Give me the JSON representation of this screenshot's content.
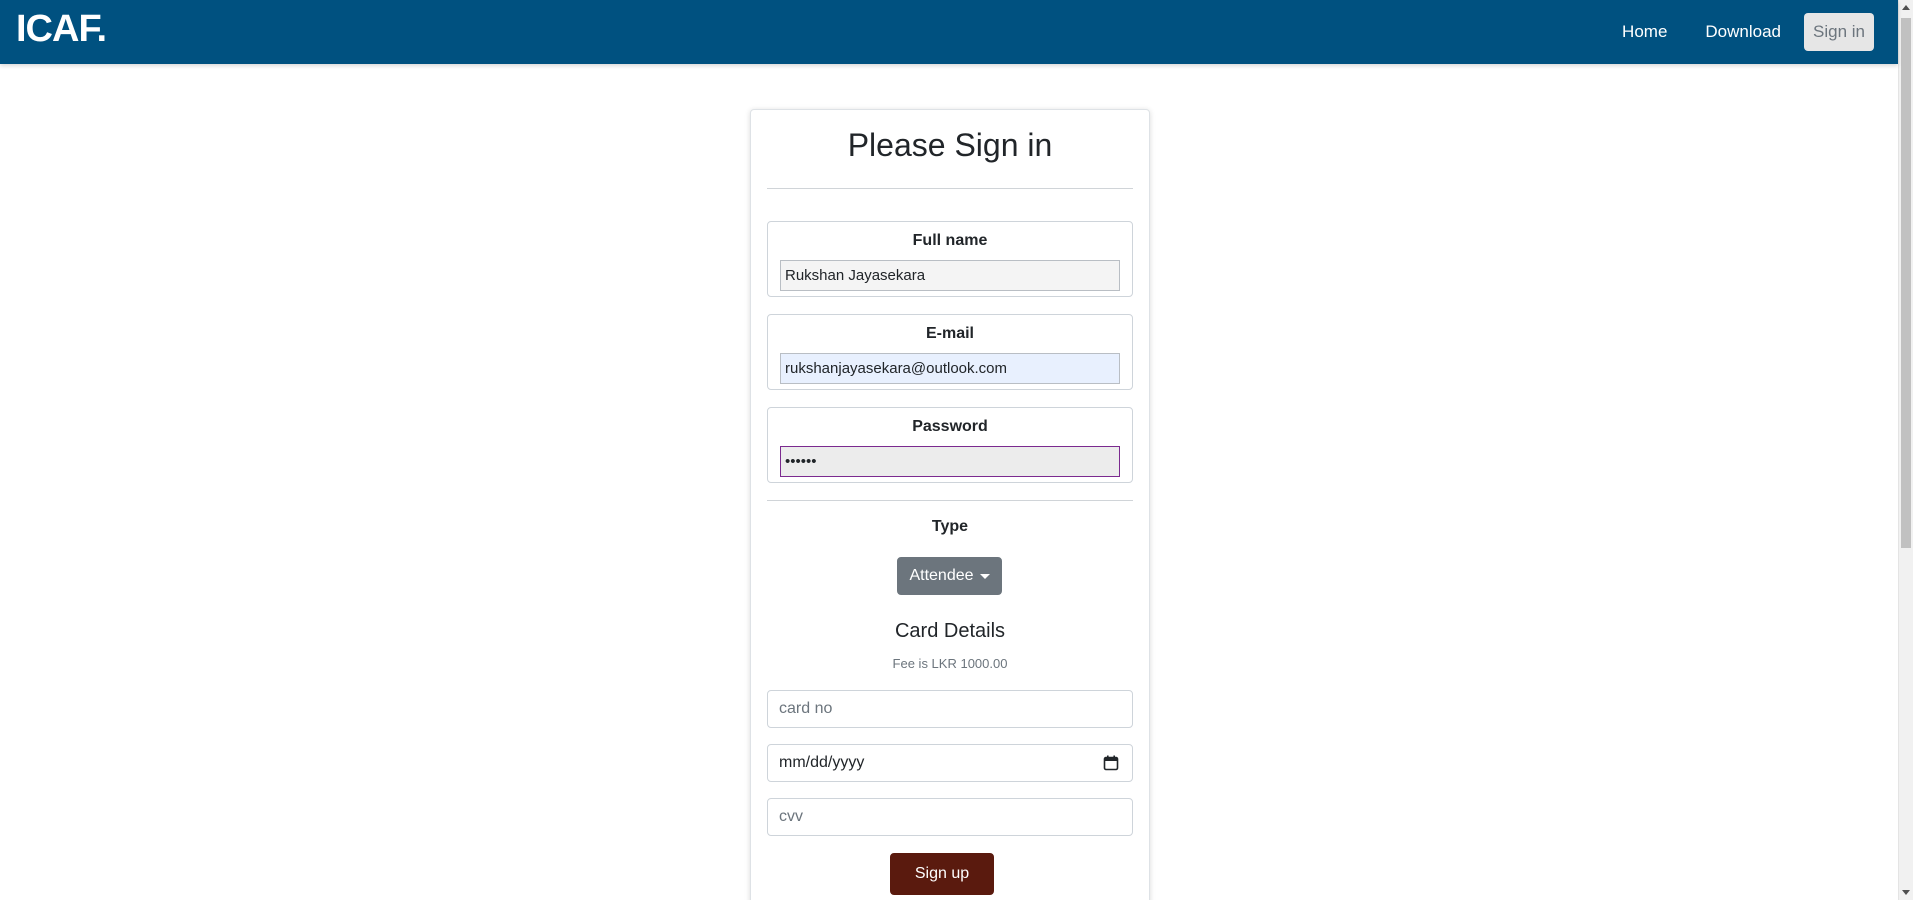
{
  "navbar": {
    "brand": "ICAF.",
    "links": [
      {
        "label": "Home"
      },
      {
        "label": "Download"
      },
      {
        "label": "Sign in"
      }
    ]
  },
  "form": {
    "title": "Please Sign in",
    "fields": {
      "full_name": {
        "label": "Full name",
        "value": "Rukshan Jayasekara"
      },
      "email": {
        "label": "E-mail",
        "value": "rukshanjayasekara@outlook.com"
      },
      "password": {
        "label": "Password",
        "value": "••••••"
      }
    },
    "type": {
      "label": "Type",
      "selected": "Attendee"
    },
    "card_details": {
      "title": "Card Details",
      "fee_note": "Fee is LKR 1000.00",
      "card_no_placeholder": "card no",
      "date_placeholder": "mm/dd/yyyy",
      "cvv_placeholder": "cvv"
    },
    "submit_label": "Sign up"
  },
  "colors": {
    "navbar": "#005180",
    "dropdown": "#6c757d",
    "submit": "#5a1a0e"
  },
  "icons": [
    "calendar-icon"
  ]
}
